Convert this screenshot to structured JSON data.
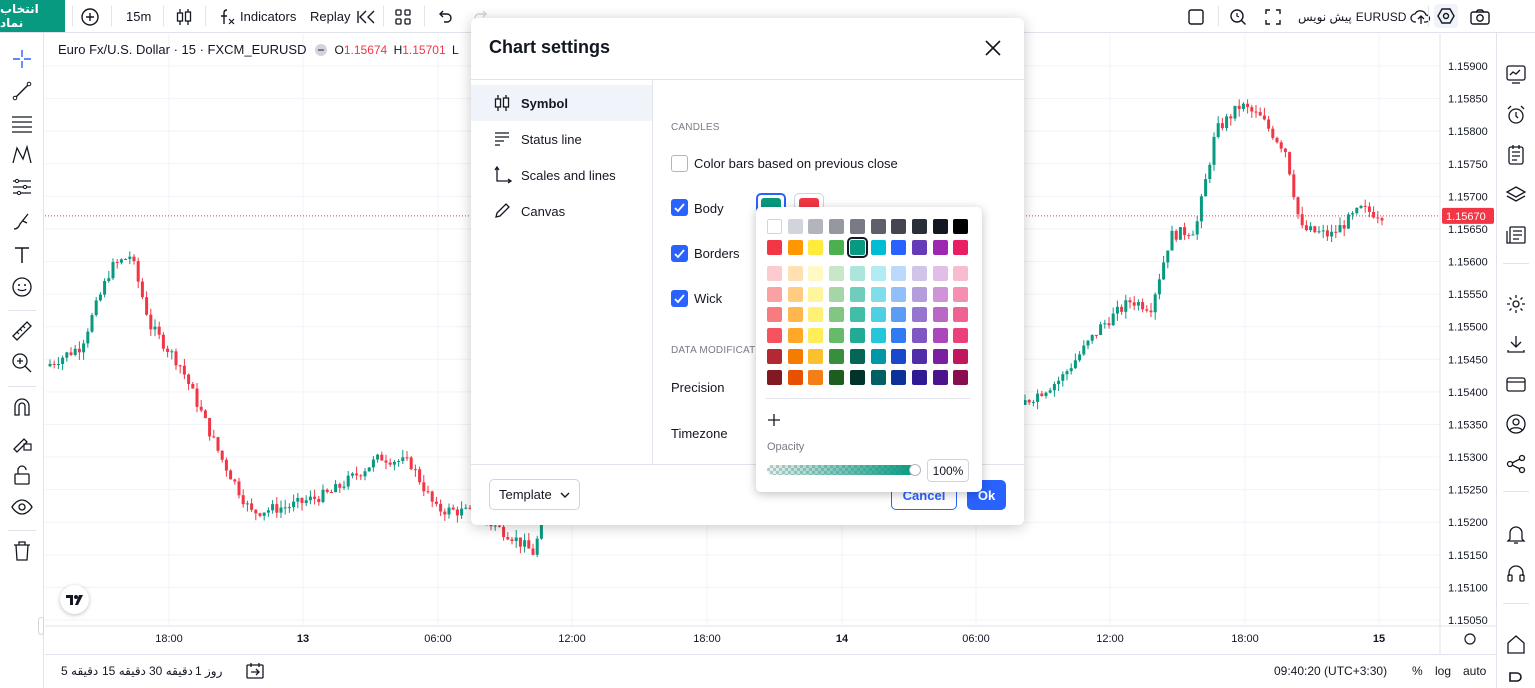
{
  "topbar": {
    "symbol_search": "انتخاب نماد",
    "interval": "15m",
    "indicators": "Indicators",
    "replay": "Replay",
    "symbol_right": "EURUSD",
    "symbol_right_prefix": "پیش نویس"
  },
  "legend": {
    "name": "Euro Fx/U.S. Dollar · 15 · FXCM_EURUSD",
    "open_label": "O",
    "open_value": "1.15674",
    "high_label": "H",
    "high_value": "1.15701",
    "trailing_letter": "L"
  },
  "price_scale": {
    "ticks": [
      "1.15900",
      "1.15850",
      "1.15800",
      "1.15750",
      "1.15700",
      "1.15650",
      "1.15600",
      "1.15550",
      "1.15500",
      "1.15450",
      "1.15400",
      "1.15350",
      "1.15300",
      "1.15250",
      "1.15200",
      "1.15150",
      "1.15100",
      "1.15050"
    ],
    "last_price": "1.15670"
  },
  "time_scale": {
    "ticks": [
      "18:00",
      "13",
      "06:00",
      "12:00",
      "18:00",
      "14",
      "06:00",
      "12:00",
      "18:00",
      "15"
    ]
  },
  "bottombar": {
    "ranges": [
      "5 دقیقه",
      "15 دقیقه",
      "30 دقیقه",
      "1 روز"
    ],
    "clock": "09:40:20 (UTC+3:30)",
    "percent": "%",
    "log": "log",
    "auto": "auto"
  },
  "dialog": {
    "title": "Chart settings",
    "tabs": [
      {
        "label": "Symbol",
        "icon": "candles-icon"
      },
      {
        "label": "Status line",
        "icon": "status-line-icon"
      },
      {
        "label": "Scales and lines",
        "icon": "scales-icon"
      },
      {
        "label": "Canvas",
        "icon": "canvas-pencil-icon"
      }
    ],
    "candles_section": "CANDLES",
    "color_bars_label": "Color bars based on previous close",
    "body_label": "Body",
    "borders_label": "Borders",
    "wick_label": "Wick",
    "data_mod_section": "DATA MODIFICATION",
    "precision_label": "Precision",
    "timezone_label": "Timezone",
    "template_label": "Template",
    "cancel_label": "Cancel",
    "ok_label": "Ok",
    "body_up_color": "#089981",
    "body_down_color": "#f23645"
  },
  "picker": {
    "opacity_label": "Opacity",
    "opacity_value": "100%",
    "opacity_fraction": 1.0,
    "grays": [
      "#ffffff",
      "#d1d4dc",
      "#b2b5be",
      "#9598a1",
      "#787b86",
      "#5d606b",
      "#434651",
      "#2a2e39",
      "#131722",
      "#000000"
    ],
    "main": [
      "#f23645",
      "#ff9800",
      "#ffeb3b",
      "#4caf50",
      "#089981",
      "#00bcd4",
      "#2962ff",
      "#673ab7",
      "#9c27b0",
      "#e91e63"
    ],
    "shades": [
      [
        "#fccbcd",
        "#ffe0b2",
        "#fff9c4",
        "#c8e6c9",
        "#ace5dc",
        "#b2ebf2",
        "#bbd9fb",
        "#d1c4e9",
        "#e1bee7",
        "#f8bbd0"
      ],
      [
        "#faa1a4",
        "#ffcc80",
        "#fff59d",
        "#a5d6a7",
        "#70ccbd",
        "#80deea",
        "#90bff9",
        "#b39ddb",
        "#ce93d8",
        "#f48fb1"
      ],
      [
        "#f77c80",
        "#ffb74d",
        "#fff176",
        "#81c784",
        "#42bda8",
        "#4dd0e1",
        "#5b9cf6",
        "#9575cd",
        "#ba68c8",
        "#f06292"
      ],
      [
        "#f7525f",
        "#ffa726",
        "#ffee58",
        "#66bb6a",
        "#22ab94",
        "#26c6da",
        "#3179f5",
        "#7e57c2",
        "#ab47bc",
        "#ec407a"
      ],
      [
        "#b22833",
        "#f57c00",
        "#fbc02d",
        "#388e3c",
        "#056656",
        "#0097a7",
        "#1848cc",
        "#512da8",
        "#7b1fa2",
        "#c2185b"
      ],
      [
        "#801922",
        "#e65100",
        "#f57f17",
        "#1b5e20",
        "#00332a",
        "#006064",
        "#0c3299",
        "#311b92",
        "#4a148c",
        "#880e4f"
      ]
    ],
    "selected": "#089981"
  }
}
